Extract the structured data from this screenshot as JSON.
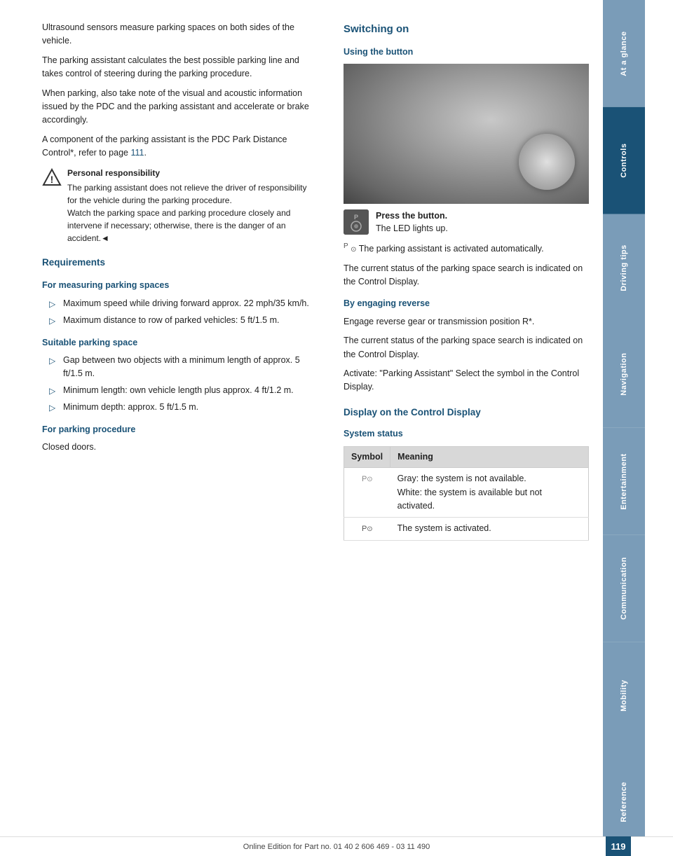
{
  "left": {
    "intro_paragraphs": [
      "Ultrasound sensors measure parking spaces on both sides of the vehicle.",
      "The parking assistant calculates the best possible parking line and takes control of steering during the parking procedure.",
      "When parking, also take note of the visual and acoustic information issued by the PDC and the parking assistant and accelerate or brake accordingly.",
      "A component of the parking assistant is the PDC Park Distance Control*, refer to page"
    ],
    "page_ref": "111",
    "page_ref_suffix": ".",
    "warning": {
      "title": "Personal responsibility",
      "text": "The parking assistant does not relieve the driver of responsibility for the vehicle during the parking procedure.",
      "text2": "Watch the parking space and parking procedure closely and intervene if necessary; otherwise, there is the danger of an accident.◄"
    },
    "requirements_title": "Requirements",
    "for_measuring_title": "For measuring parking spaces",
    "measuring_bullets": [
      "Maximum speed while driving forward approx. 22 mph/35 km/h.",
      "Maximum distance to row of parked vehicles: 5 ft/1.5 m."
    ],
    "suitable_parking_title": "Suitable parking space",
    "suitable_bullets": [
      "Gap between two objects with a minimum length of approx. 5 ft/1.5 m.",
      "Minimum length: own vehicle length plus approx. 4 ft/1.2 m.",
      "Minimum depth: approx. 5 ft/1.5 m."
    ],
    "for_parking_title": "For parking procedure",
    "for_parking_text": "Closed doors."
  },
  "right": {
    "switching_on_title": "Switching on",
    "using_button_title": "Using the button",
    "button_desc_1": "Press the button.",
    "button_desc_2": "The LED lights up.",
    "auto_text": "The parking assistant is activated automatically.",
    "status_text": "The current status of the parking space search is indicated on the Control Display.",
    "by_engaging_title": "By engaging reverse",
    "engage_text": "Engage reverse gear or transmission position R*.",
    "current_status_text": "The current status of the parking space search is indicated on the Control Display.",
    "activate_text": "Activate:  \"Parking Assistant\" Select the symbol in the Control Display.",
    "display_title": "Display on the Control Display",
    "system_status_title": "System status",
    "table": {
      "col1": "Symbol",
      "col2": "Meaning",
      "rows": [
        {
          "symbol": "P⊙",
          "meaning_lines": [
            "Gray: the system is not available.",
            "White: the system is available but not activated."
          ]
        },
        {
          "symbol": "P⊙",
          "meaning_lines": [
            "The system is activated."
          ]
        }
      ]
    }
  },
  "sidebar": {
    "tabs": [
      {
        "label": "At a glance",
        "class": "at-a-glance"
      },
      {
        "label": "Controls",
        "class": "controls"
      },
      {
        "label": "Driving tips",
        "class": "driving-tips"
      },
      {
        "label": "Navigation",
        "class": "navigation"
      },
      {
        "label": "Entertainment",
        "class": "entertainment"
      },
      {
        "label": "Communication",
        "class": "communication"
      },
      {
        "label": "Mobility",
        "class": "mobility"
      },
      {
        "label": "Reference",
        "class": "reference"
      }
    ]
  },
  "footer": {
    "text": "Online Edition for Part no. 01 40 2 606 469 - 03 11 490",
    "page": "119"
  }
}
